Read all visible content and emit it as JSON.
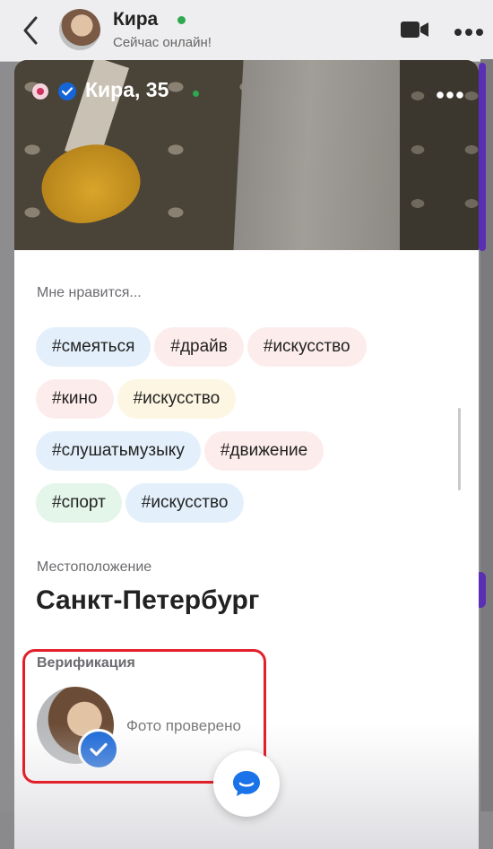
{
  "chat_header": {
    "name": "Кира",
    "status": "Сейчас онлайн!"
  },
  "profile": {
    "title": "Кира, 35",
    "likes_label": "Мне нравится...",
    "tags": [
      {
        "text": "#смеяться",
        "color": "#e3f0fb"
      },
      {
        "text": "#драйв",
        "color": "#fdecec"
      },
      {
        "text": "#искусство",
        "color": "#fdecec"
      },
      {
        "text": "#кино",
        "color": "#fdecec"
      },
      {
        "text": "#искусство",
        "color": "#fdf6e2"
      },
      {
        "text": "#слушатьмузыку",
        "color": "#e3f0fb"
      },
      {
        "text": "#движение",
        "color": "#fdecec"
      },
      {
        "text": "#спорт",
        "color": "#e4f5ea"
      },
      {
        "text": "#искусство",
        "color": "#e3f0fb"
      }
    ],
    "location_label": "Местоположение",
    "location": "Санкт-Петербург",
    "verification_label": "Верификация",
    "verification_text": "Фото проверено"
  },
  "colors": {
    "accent": "#1565d8",
    "online": "#2fa84f",
    "highlight": "#e2202a"
  }
}
